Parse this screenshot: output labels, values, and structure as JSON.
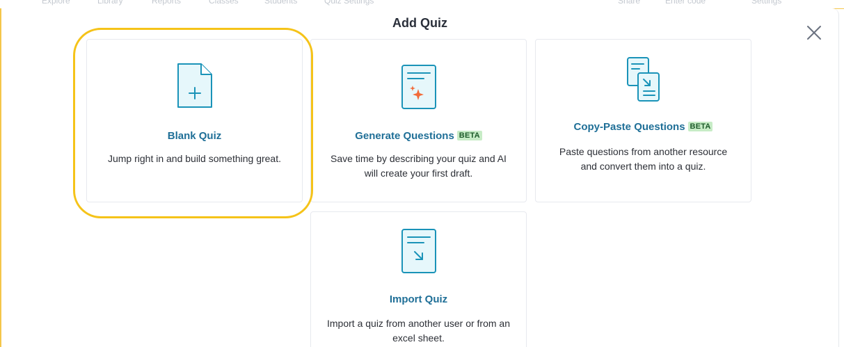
{
  "background_nav": {
    "items": [
      "Explore",
      "Library",
      "Reports",
      "Classes",
      "Students",
      "Quiz Settings",
      "Share",
      "Enter code",
      "Settings"
    ]
  },
  "modal": {
    "title": "Add Quiz",
    "close_icon": "close-icon"
  },
  "options": [
    {
      "title": "Blank Quiz",
      "badge": "",
      "description": "Jump right in and build something great.",
      "icon": "blank-document-icon",
      "highlighted": true
    },
    {
      "title": "Generate Questions",
      "badge": "BETA",
      "description": "Save time by describing your quiz and AI will create your first draft.",
      "icon": "ai-sparkle-document-icon",
      "highlighted": false
    },
    {
      "title": "Copy-Paste Questions",
      "badge": "BETA",
      "description": "Paste questions from another resource and convert them into a quiz.",
      "icon": "copy-paste-documents-icon",
      "highlighted": false
    },
    {
      "title": "Import Quiz",
      "badge": "",
      "description": "Import a quiz from another user or from an excel sheet.",
      "icon": "import-document-icon",
      "highlighted": false
    }
  ],
  "colors": {
    "accent_title": "#1f6f97",
    "icon_stroke": "#1a93b8",
    "icon_fill": "#e6f7fb",
    "sparkle": "#f26b3a",
    "badge_bg": "#c7ecc6",
    "highlight": "#f5c319"
  }
}
